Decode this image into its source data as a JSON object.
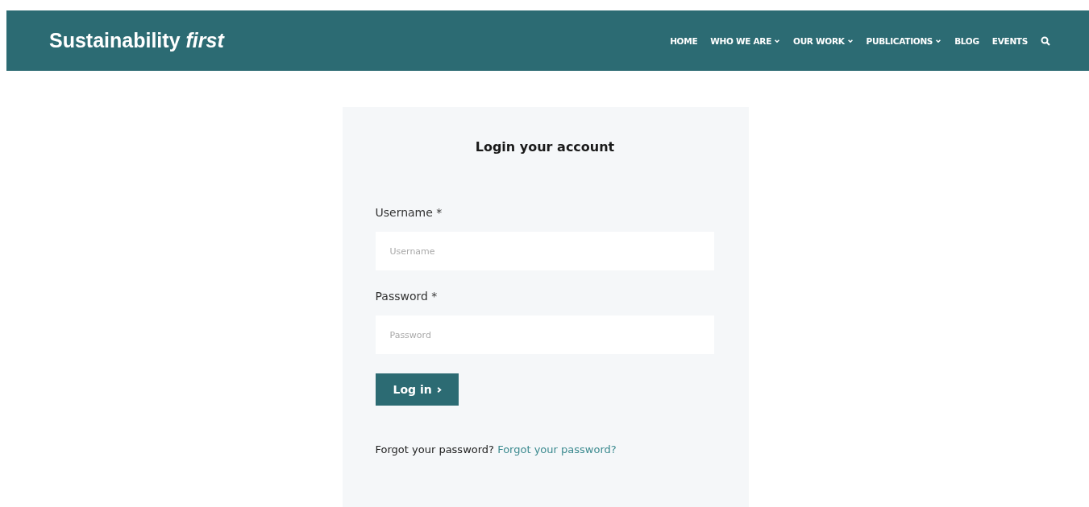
{
  "header": {
    "logo": "Sustainability *first*",
    "nav": [
      {
        "label": "HOME",
        "has_dropdown": false
      },
      {
        "label": "WHO WE ARE",
        "has_dropdown": true
      },
      {
        "label": "OUR WORK",
        "has_dropdown": true
      },
      {
        "label": "PUBLICATIONS",
        "has_dropdown": true
      },
      {
        "label": "BLOG",
        "has_dropdown": false
      },
      {
        "label": "EVENTS",
        "has_dropdown": false
      }
    ]
  },
  "login": {
    "title": "Login your account",
    "fields": [
      {
        "label": "Username *",
        "placeholder": "Username"
      },
      {
        "label": "Password *",
        "placeholder": "Password"
      }
    ],
    "button": "Log in",
    "forgot_text": "Forgot your password?",
    "forgot_link": "Forgot your password?"
  }
}
